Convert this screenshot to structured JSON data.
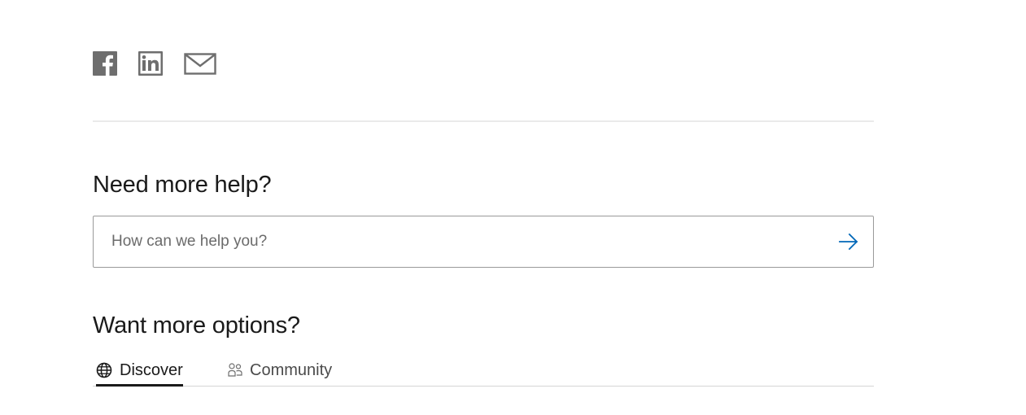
{
  "share": {
    "icons": [
      "facebook-icon",
      "linkedin-icon",
      "email-icon"
    ],
    "icon_color": "#6e6e6e"
  },
  "help": {
    "heading": "Need more help?",
    "search": {
      "placeholder": "How can we help you?",
      "value": "",
      "submit_icon": "arrow-right-icon",
      "submit_color": "#0067b8"
    }
  },
  "options": {
    "heading": "Want more options?",
    "tabs": [
      {
        "label": "Discover",
        "icon": "globe-icon",
        "selected": true
      },
      {
        "label": "Community",
        "icon": "people-icon",
        "selected": false
      }
    ]
  }
}
